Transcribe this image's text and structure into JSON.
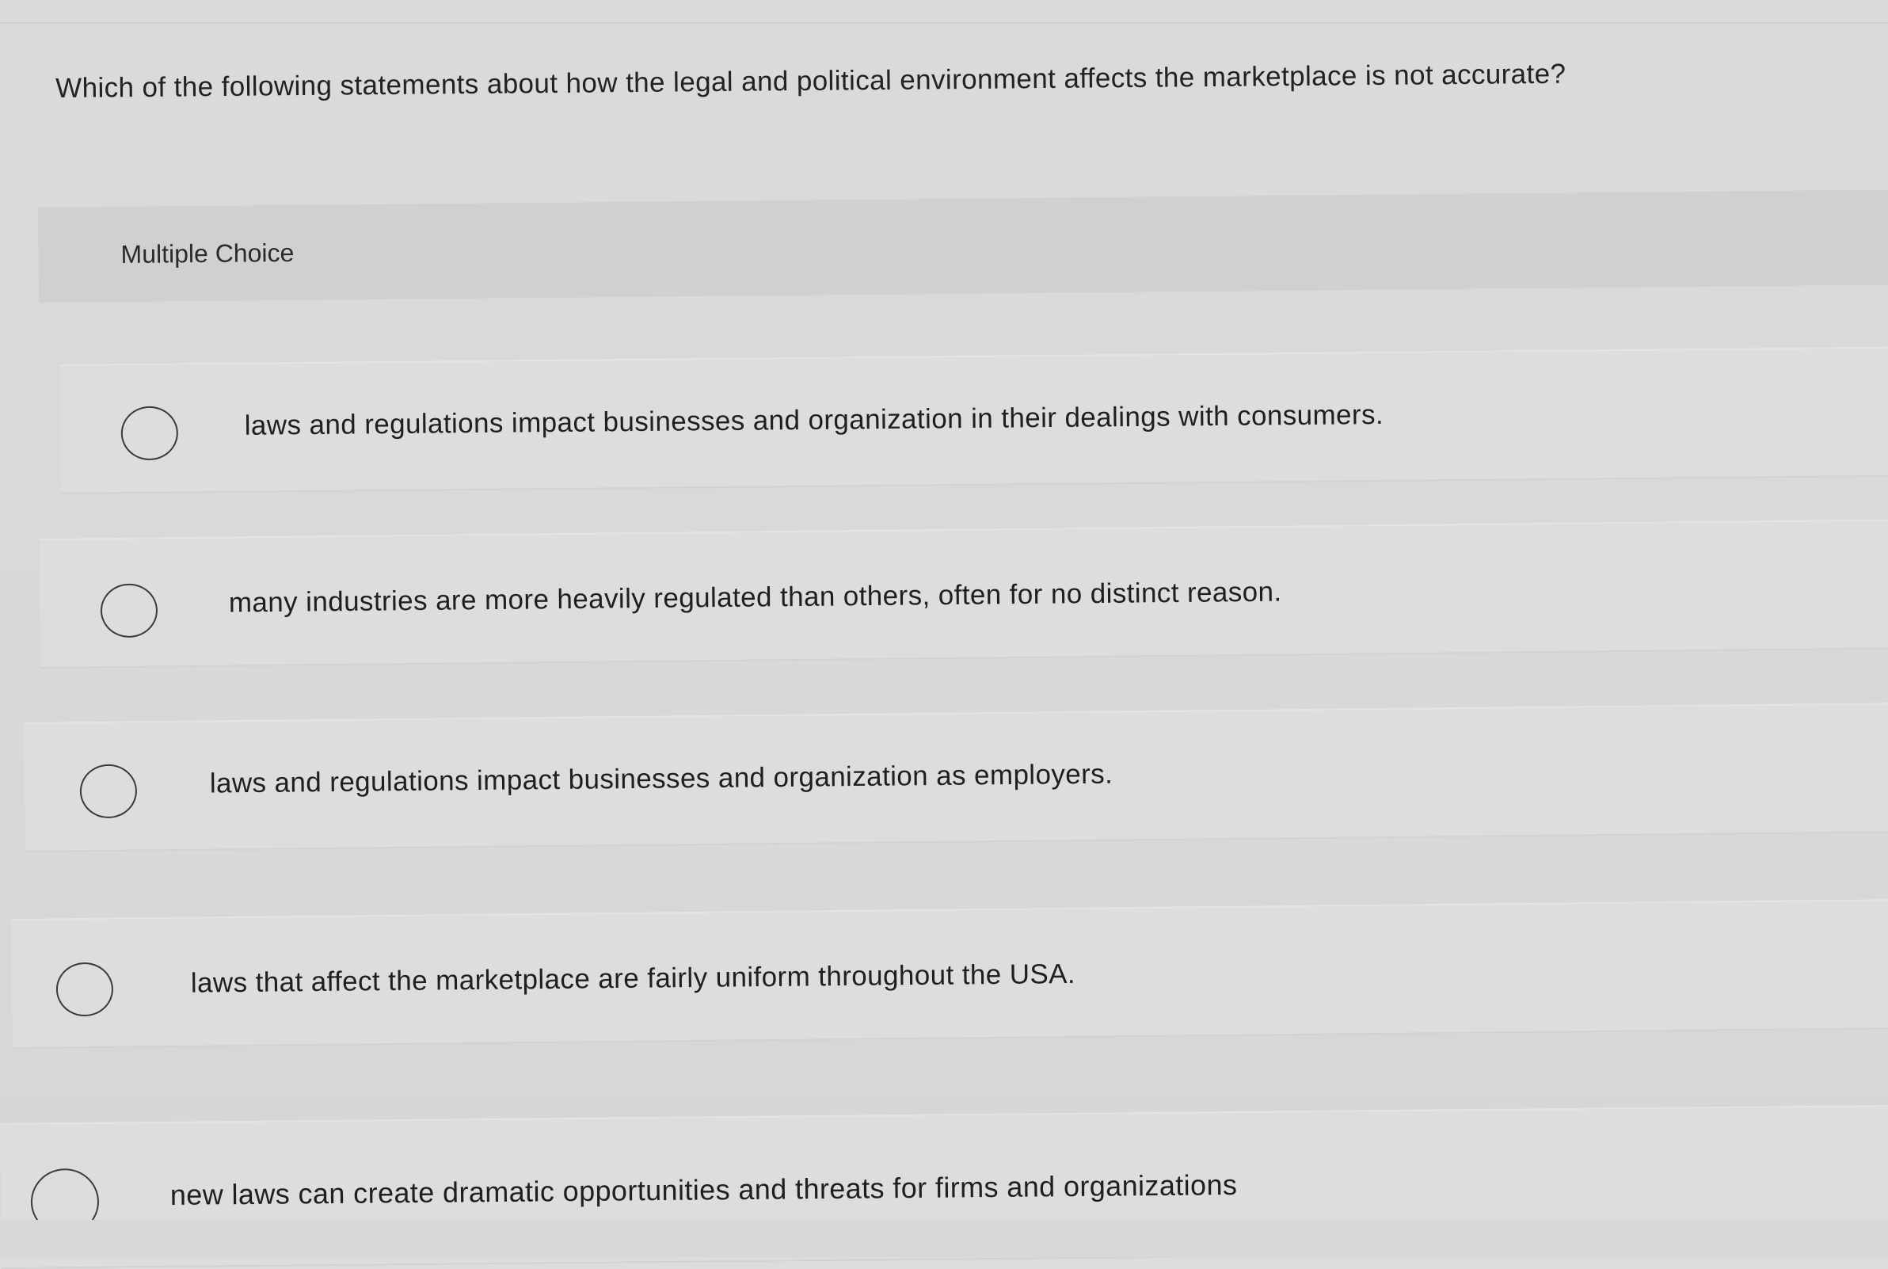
{
  "question": {
    "text": "Which of the following statements about how the legal and political environment affects the marketplace is not accurate?"
  },
  "section": {
    "label": "Multiple Choice"
  },
  "options": [
    {
      "text": "laws and regulations impact businesses and organization in their dealings with consumers.",
      "selected": false
    },
    {
      "text": "many industries are more heavily regulated than others, often for no distinct reason.",
      "selected": false
    },
    {
      "text": "laws and regulations impact businesses and organization as employers.",
      "selected": false
    },
    {
      "text": "laws that affect the marketplace are fairly uniform throughout the USA.",
      "selected": false
    },
    {
      "text": "new laws can create dramatic opportunities and threats for firms and organizations",
      "selected": false
    }
  ],
  "icons": {
    "radio": "radio-unchecked-icon"
  },
  "colors": {
    "background": "#dcdcdb",
    "header_band": "#d0d0cf",
    "text": "#1f1f1f",
    "radio_border": "#3a3a3a"
  }
}
